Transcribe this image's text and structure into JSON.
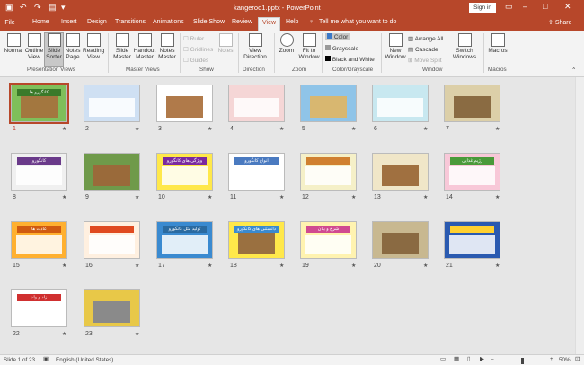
{
  "window": {
    "title": "kangeroo1.pptx  -  PowerPoint",
    "sign_in": "Sign in"
  },
  "tabs": [
    "File",
    "Home",
    "Insert",
    "Design",
    "Transitions",
    "Animations",
    "Slide Show",
    "Review",
    "View",
    "Help"
  ],
  "tell_me": "Tell me what you want to do",
  "share": "Share",
  "ribbon": {
    "presentation_views": {
      "label": "Presentation Views",
      "normal": "Normal",
      "outline": "Outline View",
      "sorter": "Slide Sorter",
      "notes": "Notes Page",
      "reading": "Reading View"
    },
    "master_views": {
      "label": "Master Views",
      "slide": "Slide Master",
      "handout": "Handout Master",
      "notes": "Notes Master"
    },
    "show": {
      "label": "Show",
      "ruler": "Ruler",
      "gridlines": "Gridlines",
      "guides": "Guides",
      "notes": "Notes"
    },
    "direction": {
      "label": "Direction",
      "text": "View Direction"
    },
    "zoom": {
      "label": "Zoom",
      "zoom": "Zoom",
      "fit": "Fit to Window"
    },
    "color": {
      "label": "Color/Grayscale",
      "color": "Color",
      "grayscale": "Grayscale",
      "bw": "Black and White"
    },
    "window_grp": {
      "label": "Window",
      "new": "New Window",
      "arrange": "Arrange All",
      "cascade": "Cascade",
      "move": "Move Split",
      "switch": "Switch Windows"
    },
    "macros": {
      "label": "Macros",
      "macros": "Macros"
    }
  },
  "slides": [
    {
      "num": "1",
      "bg": "#7fbf5a",
      "head": "#3a7a2a",
      "type": "pic",
      "pic": "#a3773f",
      "head_text": "کانگورو ها"
    },
    {
      "num": "2",
      "bg": "#cfe0f3",
      "head": "",
      "type": "text"
    },
    {
      "num": "3",
      "bg": "#ffffff",
      "head": "",
      "type": "pic",
      "pic": "#b07a4a"
    },
    {
      "num": "4",
      "bg": "#f5d6d6",
      "head": "",
      "type": "text"
    },
    {
      "num": "5",
      "bg": "#8fc4e8",
      "head": "",
      "type": "pic",
      "pic": "#d8b770"
    },
    {
      "num": "6",
      "bg": "#c8e8f0",
      "head": "",
      "type": "text"
    },
    {
      "num": "7",
      "bg": "#dccfa8",
      "head": "",
      "type": "pic",
      "pic": "#8a6b42"
    },
    {
      "num": "8",
      "bg": "#f0f0f0",
      "head": "#6a3a8a",
      "type": "text",
      "head_text": "کانگورو"
    },
    {
      "num": "9",
      "bg": "#6f9a4a",
      "head": "",
      "type": "pic",
      "pic": "#9a6a3a"
    },
    {
      "num": "10",
      "bg": "#ffe84a",
      "head": "#7a2aa0",
      "type": "text",
      "head_text": "ویژگی های کانگورو"
    },
    {
      "num": "11",
      "bg": "#ffffff",
      "head": "#4a7ac0",
      "type": "text",
      "head_text": "انواع کانگورو"
    },
    {
      "num": "12",
      "bg": "#f5f0c8",
      "head": "#d08030",
      "type": "text"
    },
    {
      "num": "13",
      "bg": "#f0e6c8",
      "head": "",
      "type": "pic",
      "pic": "#a07040"
    },
    {
      "num": "14",
      "bg": "#f8c8d8",
      "head": "#4a9a3a",
      "type": "text",
      "head_text": "رژیم غذایی"
    },
    {
      "num": "15",
      "bg": "#ffb030",
      "head": "#d05a10",
      "type": "text",
      "head_text": "عادت ها"
    },
    {
      "num": "16",
      "bg": "#fff0e0",
      "head": "#e04a20",
      "type": "text"
    },
    {
      "num": "17",
      "bg": "#3a8ad0",
      "head": "#2a6aa0",
      "type": "text",
      "head_text": "تولید مثل کانگورو"
    },
    {
      "num": "18",
      "bg": "#ffe84a",
      "head": "#3a8ad0",
      "type": "pic",
      "pic": "#9a7040",
      "head_text": "دانستنی های کانگورو"
    },
    {
      "num": "19",
      "bg": "#fff3b0",
      "head": "#d04a90",
      "type": "text",
      "head_text": "شرح و بیان"
    },
    {
      "num": "20",
      "bg": "#c8b890",
      "head": "",
      "type": "pic",
      "pic": "#8a6a42"
    },
    {
      "num": "21",
      "bg": "#2a5ab0",
      "head": "#ffd030",
      "type": "text"
    },
    {
      "num": "22",
      "bg": "#ffffff",
      "head": "#d03030",
      "type": "text",
      "head_text": "زاد و ولد"
    },
    {
      "num": "23",
      "bg": "#e8c848",
      "head": "",
      "type": "pic",
      "pic": "#8a8a8a"
    }
  ],
  "status": {
    "slide": "Slide 1 of 23",
    "language": "English (United States)",
    "zoom": "50%"
  }
}
